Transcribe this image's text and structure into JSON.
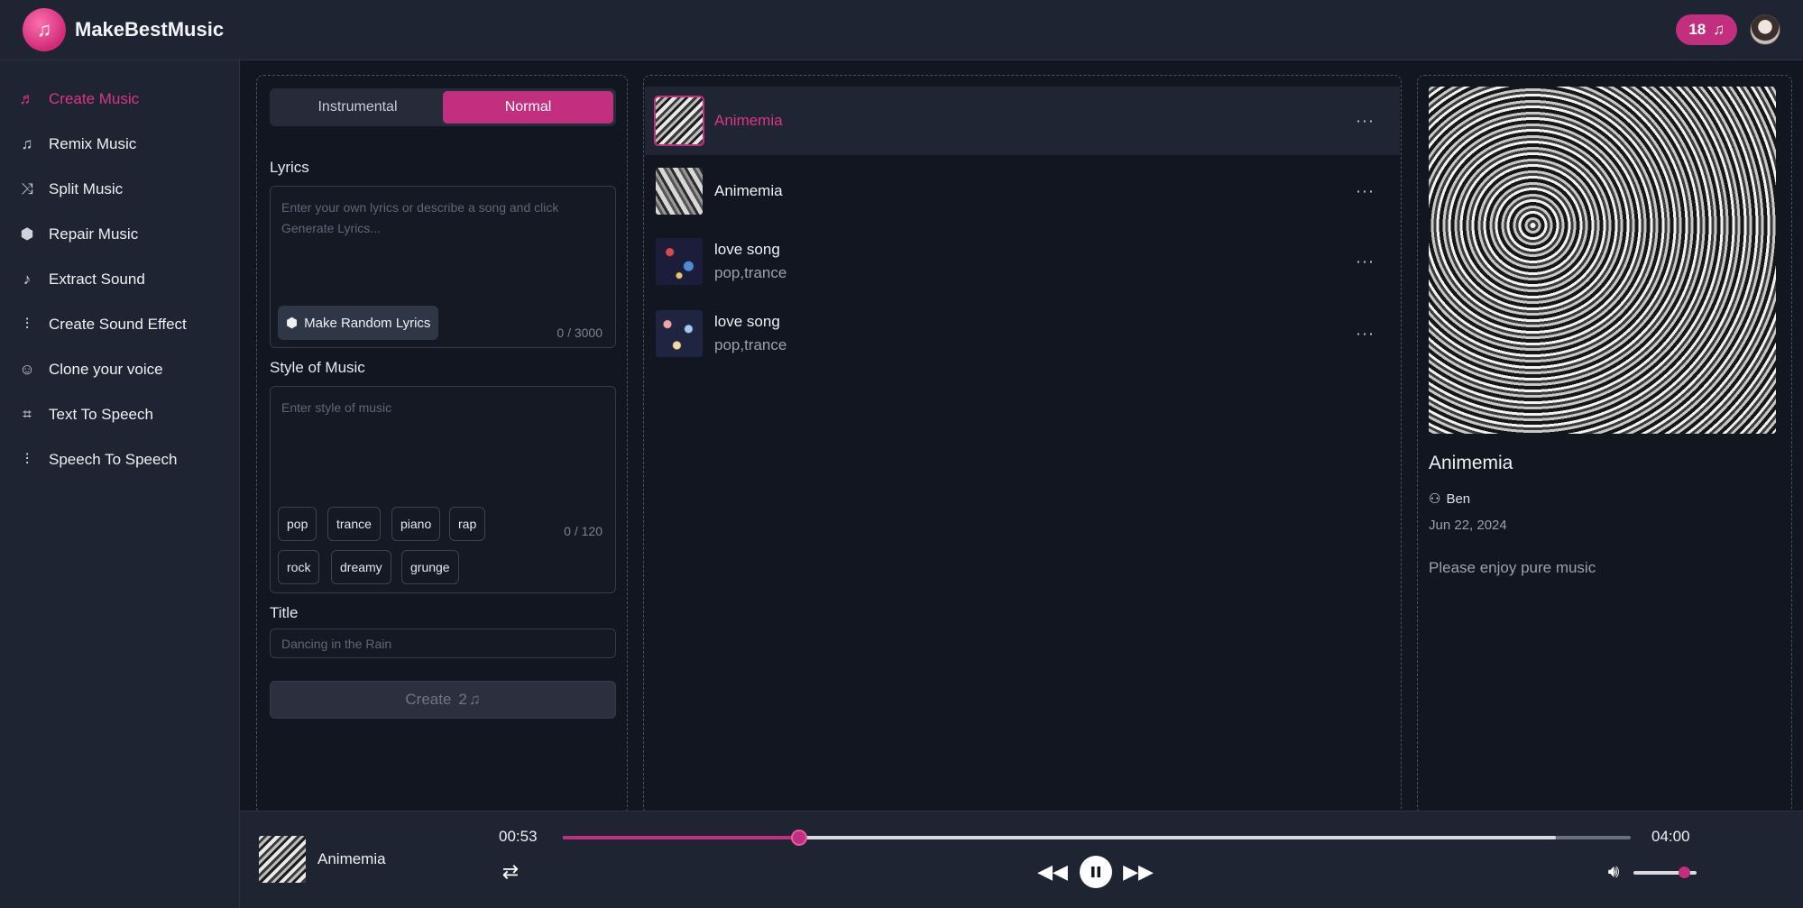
{
  "app": {
    "name": "MakeBestMusic",
    "credits": "18",
    "logo_icon": "music-note-icon"
  },
  "sidebar": {
    "items": [
      {
        "label": "Create Music",
        "icon": "music-note-icon",
        "active": true
      },
      {
        "label": "Remix Music",
        "icon": "remix-icon",
        "active": false
      },
      {
        "label": "Split Music",
        "icon": "split-icon",
        "active": false
      },
      {
        "label": "Repair Music",
        "icon": "repair-icon",
        "active": false
      },
      {
        "label": "Extract Sound",
        "icon": "extract-icon",
        "active": false
      },
      {
        "label": "Create Sound Effect",
        "icon": "waveform-icon",
        "active": false
      },
      {
        "label": "Clone your voice",
        "icon": "voice-icon",
        "active": false
      },
      {
        "label": "Text To Speech",
        "icon": "tts-icon",
        "active": false
      },
      {
        "label": "Speech To Speech",
        "icon": "waveform-icon",
        "active": false
      }
    ]
  },
  "form": {
    "mode_instrumental": "Instrumental",
    "mode_normal": "Normal",
    "lyrics_label": "Lyrics",
    "lyrics_placeholder": "Enter your own lyrics or describe a song and click Generate Lyrics...",
    "random_lyrics": "Make Random Lyrics",
    "lyrics_counter": "0 / 3000",
    "style_label": "Style of Music",
    "style_placeholder": "Enter style of music",
    "style_counter": "0 / 120",
    "tags": [
      "pop",
      "trance",
      "piano",
      "rap",
      "rock",
      "dreamy",
      "grunge"
    ],
    "title_label": "Title",
    "title_placeholder": "Dancing in the Rain",
    "create_label": "Create",
    "create_cost": "2"
  },
  "songs": [
    {
      "title": "Animemia",
      "sub": "",
      "selected": true
    },
    {
      "title": "Animemia",
      "sub": "",
      "selected": false
    },
    {
      "title": "love song",
      "sub": "pop,trance",
      "selected": false
    },
    {
      "title": "love song",
      "sub": "pop,trance",
      "selected": false
    }
  ],
  "detail": {
    "title": "Animemia",
    "author": "Ben",
    "date": "Jun 22, 2024",
    "description": "Please enjoy pure music"
  },
  "player": {
    "title": "Animemia",
    "current": "00:53",
    "total": "04:00",
    "progress": 0.221,
    "buffered": 0.93,
    "volume": 0.8
  },
  "colors": {
    "accent": "#c22f7f",
    "bg": "#121620",
    "panel": "#1e2431"
  }
}
